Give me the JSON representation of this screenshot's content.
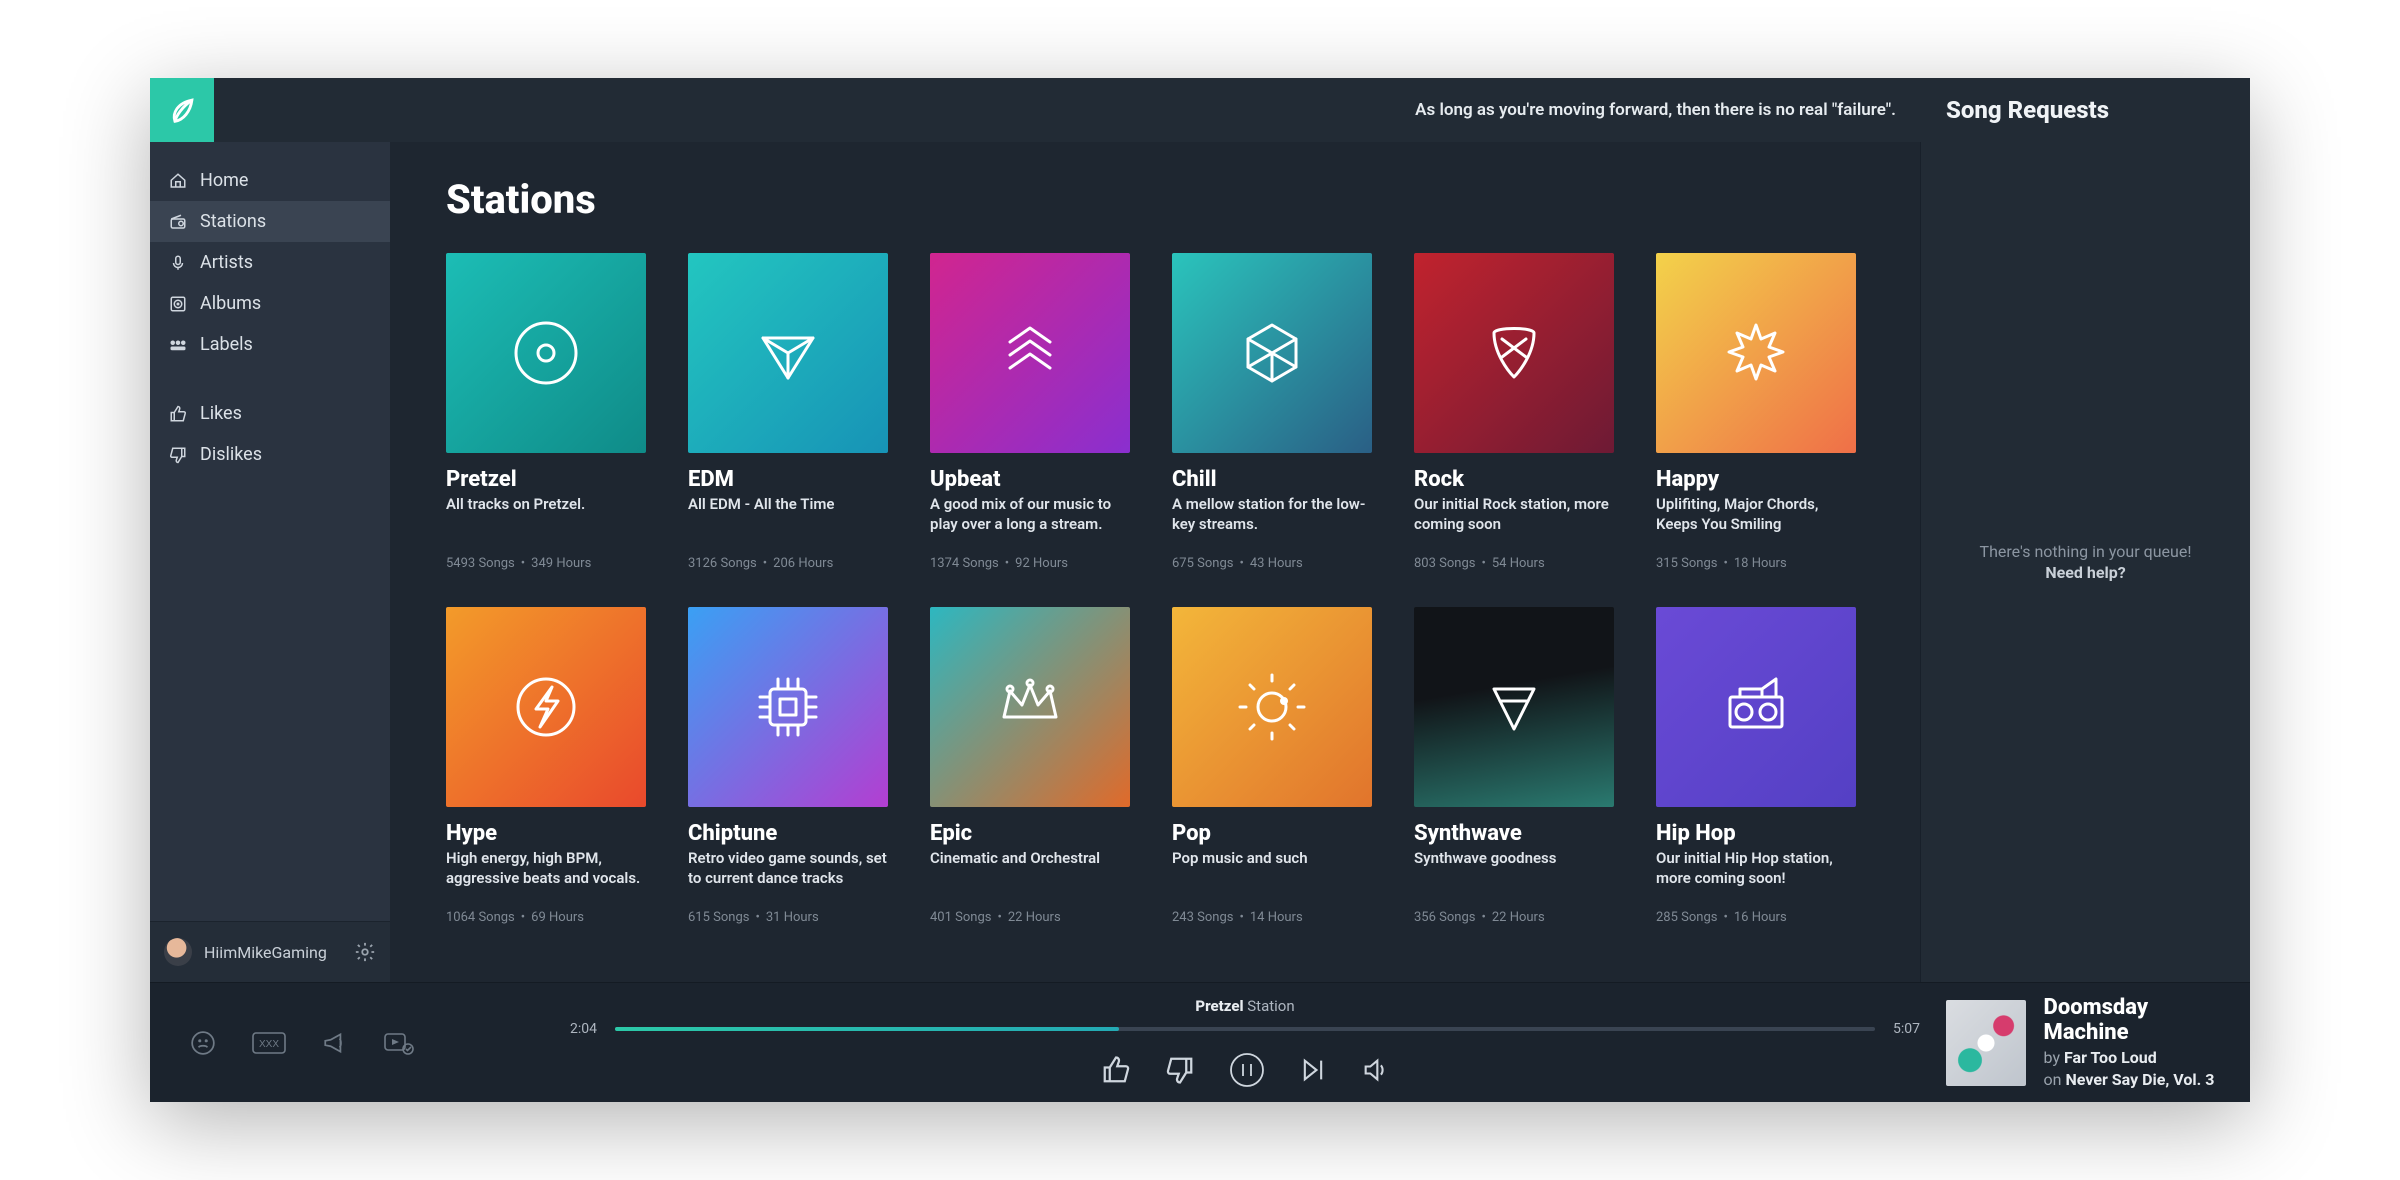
{
  "header": {
    "motto": "As long as you're moving forward, then there is no real \"failure\".",
    "requests_title": "Song Requests"
  },
  "sidebar": {
    "items": [
      {
        "label": "Home",
        "icon": "home-icon"
      },
      {
        "label": "Stations",
        "icon": "radio-icon"
      },
      {
        "label": "Artists",
        "icon": "mic-icon"
      },
      {
        "label": "Albums",
        "icon": "disc-icon"
      },
      {
        "label": "Labels",
        "icon": "people-icon"
      }
    ],
    "secondary": [
      {
        "label": "Likes",
        "icon": "thumbs-up-icon"
      },
      {
        "label": "Dislikes",
        "icon": "thumbs-down-icon"
      }
    ],
    "username": "HiimMikeGaming"
  },
  "main": {
    "title": "Stations"
  },
  "stations": [
    {
      "name": "Pretzel",
      "desc": "All tracks on Pretzel.",
      "songs": "5493 Songs",
      "hours": "349 Hours",
      "g": "g-pretzel",
      "icon": "vinyl-icon"
    },
    {
      "name": "EDM",
      "desc": "All EDM - All the Time",
      "songs": "3126 Songs",
      "hours": "206 Hours",
      "g": "g-edm",
      "icon": "diamond-icon"
    },
    {
      "name": "Upbeat",
      "desc": "A good mix of our music to play over a long a stream.",
      "songs": "1374 Songs",
      "hours": "92 Hours",
      "g": "g-upbeat",
      "icon": "chevrons-up-icon"
    },
    {
      "name": "Chill",
      "desc": "A mellow station for the low-key streams.",
      "songs": "675 Songs",
      "hours": "43 Hours",
      "g": "g-chill",
      "icon": "hexagon-icon"
    },
    {
      "name": "Rock",
      "desc": "Our initial Rock station, more coming soon",
      "songs": "803 Songs",
      "hours": "54 Hours",
      "g": "g-rock",
      "icon": "pick-icon"
    },
    {
      "name": "Happy",
      "desc": "Uplifiting, Major Chords, Keeps You Smiling",
      "songs": "315 Songs",
      "hours": "18 Hours",
      "g": "g-happy",
      "icon": "burst-icon"
    },
    {
      "name": "Hype",
      "desc": "High energy, high BPM, aggressive beats and vocals.",
      "songs": "1064 Songs",
      "hours": "69 Hours",
      "g": "g-hype",
      "icon": "bolt-circle-icon"
    },
    {
      "name": "Chiptune",
      "desc": "Retro video game sounds, set to current dance tracks",
      "songs": "615 Songs",
      "hours": "31 Hours",
      "g": "g-chip",
      "icon": "chip-icon"
    },
    {
      "name": "Epic",
      "desc": "Cinematic and Orchestral",
      "songs": "401 Songs",
      "hours": "22 Hours",
      "g": "g-epic",
      "icon": "crown-icon"
    },
    {
      "name": "Pop",
      "desc": "Pop music and such",
      "songs": "243 Songs",
      "hours": "14 Hours",
      "g": "g-pop",
      "icon": "sun-icon"
    },
    {
      "name": "Synthwave",
      "desc": "Synthwave goodness",
      "songs": "356 Songs",
      "hours": "22 Hours",
      "g": "g-synth",
      "icon": "triangle-bar-icon"
    },
    {
      "name": "Hip Hop",
      "desc": "Our initial Hip Hop station, more coming soon!",
      "songs": "285 Songs",
      "hours": "16 Hours",
      "g": "g-hiphop",
      "icon": "boombox-icon"
    }
  ],
  "requests": {
    "empty_text": "There's nothing in your queue!",
    "help_text": "Need help?"
  },
  "player": {
    "current_time": "2:04",
    "duration": "5:07",
    "station_prefix": "Pretzel",
    "station_suffix": "Station",
    "track_title": "Doomsday Machine",
    "by_label": "by",
    "artist": "Far Too Loud",
    "on_label": "on",
    "album": "Never Say Die, Vol. 3"
  }
}
